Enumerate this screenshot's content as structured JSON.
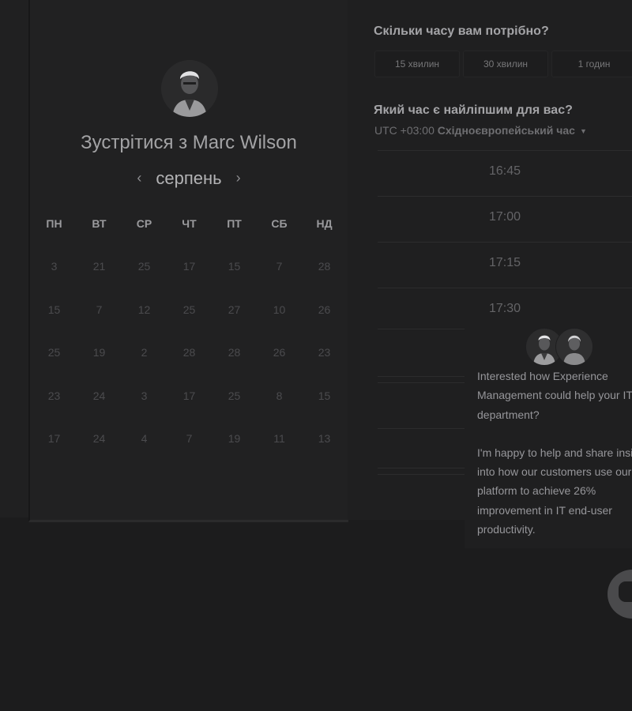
{
  "scheduler": {
    "host_title": "Зустрітися з Marc Wilson",
    "month": "серпень",
    "prev_arrow": "‹",
    "next_arrow": "›",
    "weekdays": [
      "ПН",
      "ВТ",
      "СР",
      "ЧТ",
      "ПТ",
      "СБ",
      "НД"
    ],
    "weeks": [
      [
        "3",
        "21",
        "25",
        "17",
        "15",
        "7",
        "28"
      ],
      [
        "15",
        "7",
        "12",
        "25",
        "27",
        "10",
        "26"
      ],
      [
        "25",
        "19",
        "2",
        "28",
        "28",
        "26",
        "23"
      ],
      [
        "23",
        "24",
        "3",
        "17",
        "25",
        "8",
        "15"
      ],
      [
        "17",
        "24",
        "4",
        "7",
        "19",
        "11",
        "13"
      ]
    ]
  },
  "booking": {
    "duration_question": "Скільки часу вам потрібно?",
    "durations": [
      "15 хвилин",
      "30 хвилин",
      "1 годин"
    ],
    "time_question": "Який час є найліпшим для вас?",
    "timezone_offset": "UTC +03:00",
    "timezone_name": "Східноєвропейський час",
    "slots": [
      "16:45",
      "17:00",
      "17:15",
      "17:30"
    ]
  },
  "chat": {
    "message_1": "Interested how Experience Management could help your IT department?",
    "message_2": "I'm happy to help and share insight into how our customers use our platform to achieve 26% improvement in IT end-user productivity.",
    "launcher_icon": "chat-icon"
  },
  "colors": {
    "background": "#1c1c1d",
    "panel": "#212122",
    "text": "#b9b9bb"
  }
}
